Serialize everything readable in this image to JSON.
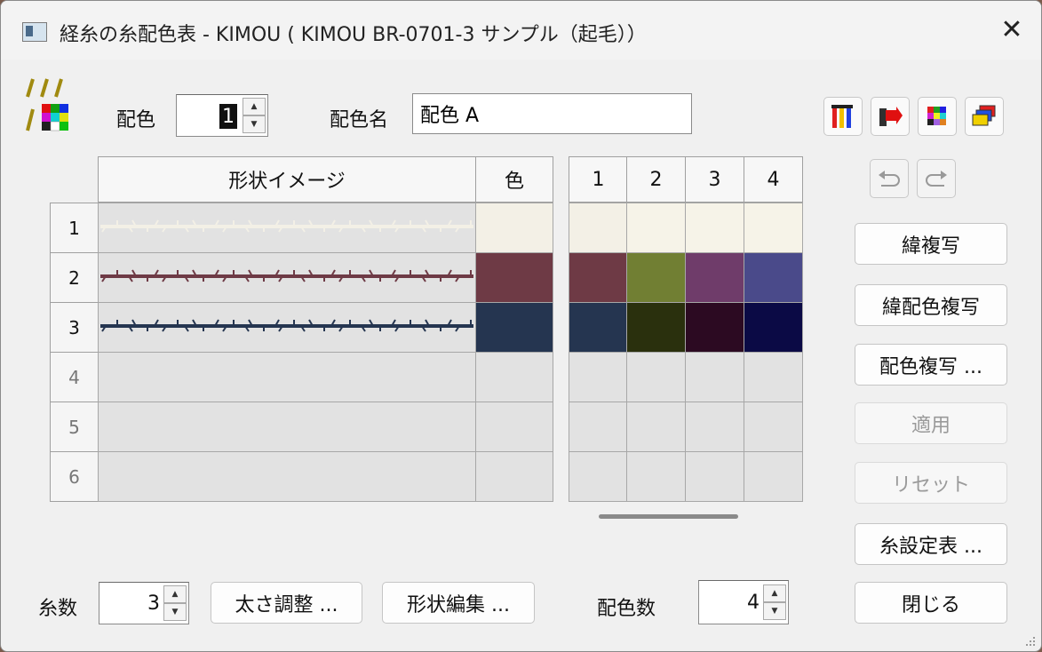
{
  "window": {
    "title": "経糸の糸配色表 - KIMOU ( KIMOU BR-0701-3 サンプル（起毛））",
    "close_icon": "close-icon"
  },
  "top": {
    "haishoku_label": "配色",
    "haishoku_value": "1",
    "haishoku_name_label": "配色名",
    "haishoku_name_value": "配色 A"
  },
  "grid": {
    "shape_header": "形状イメージ",
    "color_header": "色",
    "scheme_headers": [
      "1",
      "2",
      "3",
      "4"
    ],
    "rows": [
      {
        "num": "1",
        "color": "#f3f0e6",
        "schemes": [
          "#f3f0e6",
          "#f6f3e8",
          "#f6f3e8",
          "#f6f3e8"
        ]
      },
      {
        "num": "2",
        "color": "#6e3a45",
        "schemes": [
          "#6e3a45",
          "#717f33",
          "#6f3c6a",
          "#4a4a8a"
        ]
      },
      {
        "num": "3",
        "color": "#253550",
        "schemes": [
          "#253550",
          "#2a300d",
          "#2c0a22",
          "#0b0a45"
        ]
      },
      {
        "num": "4",
        "color": "",
        "schemes": [
          "",
          "",
          "",
          ""
        ]
      },
      {
        "num": "5",
        "color": "",
        "schemes": [
          "",
          "",
          "",
          ""
        ]
      },
      {
        "num": "6",
        "color": "",
        "schemes": [
          "",
          "",
          "",
          ""
        ]
      }
    ]
  },
  "buttons": {
    "weft_copy": "緯複写",
    "weft_color_copy": "緯配色複写",
    "color_copy": "配色複写 ...",
    "apply": "適用",
    "reset": "リセット",
    "thread_settings": "糸設定表 ...",
    "close": "閉じる",
    "thickness": "太さ調整 ...",
    "shape_edit": "形状編集 ..."
  },
  "bottom": {
    "thread_count_label": "糸数",
    "thread_count_value": "3",
    "scheme_count_label": "配色数",
    "scheme_count_value": "4"
  },
  "icons": [
    "yarn-palette-icon",
    "color-columns-icon",
    "color-arrow-icon",
    "color-swap-icon",
    "color-layers-icon",
    "undo-icon",
    "redo-icon",
    "resize-grip-icon"
  ]
}
